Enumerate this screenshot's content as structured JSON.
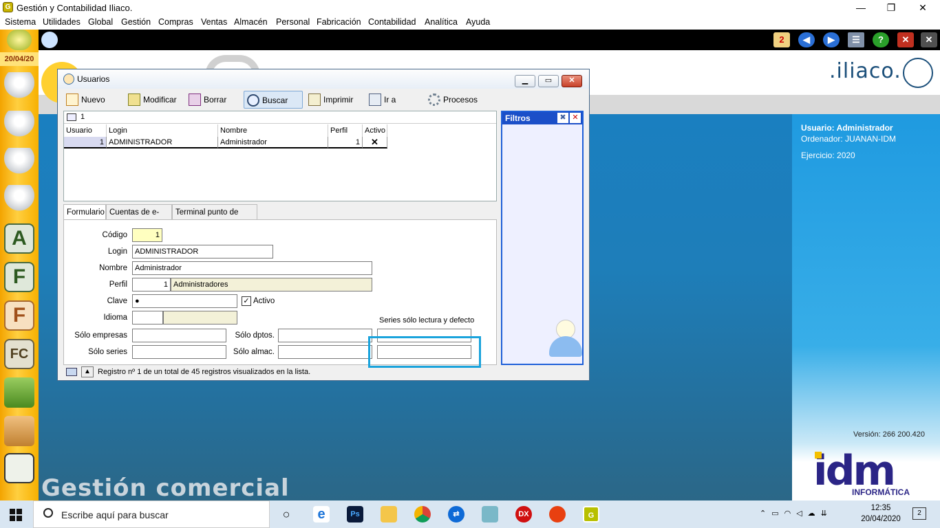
{
  "window": {
    "title": "Gestión y Contabilidad Iliaco.",
    "minimize": "—",
    "maximize": "❐",
    "close": "✕"
  },
  "menu": [
    "Sistema",
    "Utilidades",
    "Global",
    "Gestión",
    "Compras",
    "Ventas",
    "Almacén",
    "Personal",
    "Fabricación",
    "Contabilidad",
    "Analítica",
    "Ayuda"
  ],
  "sidebar": {
    "date": "20/04/20"
  },
  "brand": {
    "logo_text": ".iliaco.",
    "app_caption": "Gestión comercial",
    "idm_text": "idm",
    "idm_sub": "INFORMÁTICA",
    "version": "Versión: 266 200.420"
  },
  "session": {
    "user": "Usuario: Administrador",
    "computer": "Ordenador: JUANAN-IDM",
    "year": "Ejercicio: 2020"
  },
  "dialog": {
    "title": "Usuarios",
    "toolbar": [
      "Nuevo",
      "Modificar",
      "Borrar",
      "Buscar",
      "Imprimir",
      "Ir a",
      "Procesos"
    ],
    "filter_value": "1",
    "grid": {
      "headers": [
        "Usuario",
        "Login",
        "Nombre",
        "Perfil",
        "Activo"
      ],
      "rows": [
        {
          "usuario": "1",
          "login": "ADMINISTRADOR",
          "nombre": "Administrador",
          "perfil": "1",
          "activo": "✕"
        }
      ]
    },
    "filters_title": "Filtros",
    "tabs": [
      "Formulario",
      "Cuentas de e-mail",
      "Terminal punto de venta"
    ],
    "form": {
      "codigo_label": "Código",
      "codigo": "1",
      "login_label": "Login",
      "login": "ADMINISTRADOR",
      "nombre_label": "Nombre",
      "nombre": "Administrador",
      "perfil_label": "Perfil",
      "perfil_num": "1",
      "perfil_name": "Administradores",
      "clave_label": "Clave",
      "clave": "●",
      "activo_label": "Activo",
      "activo_check": "✓",
      "idioma_label": "Idioma",
      "series_label": "Series sólo lectura y defecto",
      "solo_empresas_label": "Sólo empresas",
      "solo_dptos_label": "Sólo dptos.",
      "solo_series_label": "Sólo series",
      "solo_almac_label": "Sólo almac."
    },
    "status": "Registro nº 1 de un total de 45 registros visualizados en la lista."
  },
  "taskbar": {
    "search_placeholder": "Escribe aquí para buscar",
    "time": "12:35",
    "date": "20/04/2020",
    "notifications": "2"
  }
}
